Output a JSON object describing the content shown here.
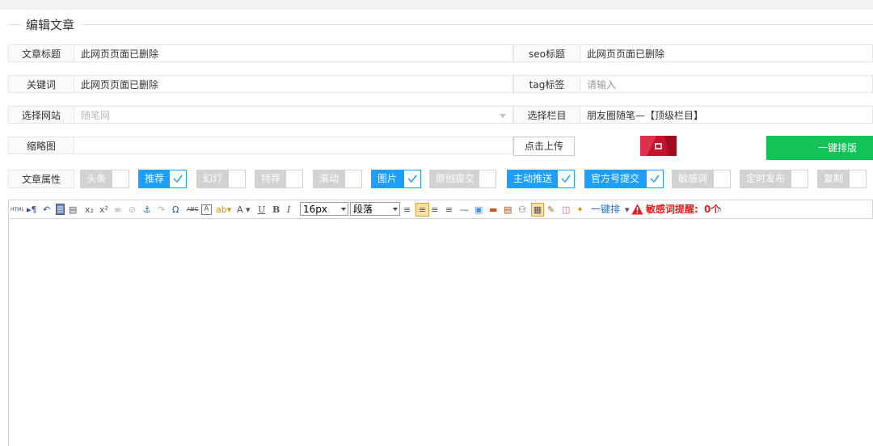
{
  "legend": "编辑文章",
  "fields": {
    "title": {
      "label": "文章标题",
      "value": "此网页页面已删除"
    },
    "seo_title": {
      "label": "seo标题",
      "value": "此网页页面已删除"
    },
    "keywords": {
      "label": "关键词",
      "value": "此网页页面已删除"
    },
    "tags": {
      "label": "tag标签",
      "placeholder": "请输入"
    },
    "site": {
      "label": "选择网站",
      "value": "随笔网"
    },
    "column": {
      "label": "选择栏目",
      "value": "朋友圈随笔—【顶级栏目】"
    },
    "thumbnail": {
      "label": "缩略图",
      "upload_label": "点击上传"
    }
  },
  "onekey_label": "一键排版",
  "attributes": {
    "label": "文章属性",
    "items": [
      {
        "label": "头条",
        "checked": false
      },
      {
        "label": "推荐",
        "checked": true
      },
      {
        "label": "幻灯",
        "checked": false
      },
      {
        "label": "特荐",
        "checked": false
      },
      {
        "label": "滚动",
        "checked": false
      },
      {
        "label": "图片",
        "checked": true
      },
      {
        "label": "原创提交",
        "checked": false
      },
      {
        "label": "主动推送",
        "checked": true
      },
      {
        "label": "官方号提交",
        "checked": true
      },
      {
        "label": "敏感词",
        "checked": false
      },
      {
        "label": "定时发布",
        "checked": false
      },
      {
        "label": "复制",
        "checked": false
      }
    ]
  },
  "toolbar": {
    "html_label": "HTML",
    "font_size": "16px",
    "paragraph": "段落",
    "onekey_label": "一键排",
    "sensitive_label": "敏感词提醒:",
    "sensitive_count": "0个",
    "accent": "#1e9fff",
    "green": "#12c357"
  }
}
